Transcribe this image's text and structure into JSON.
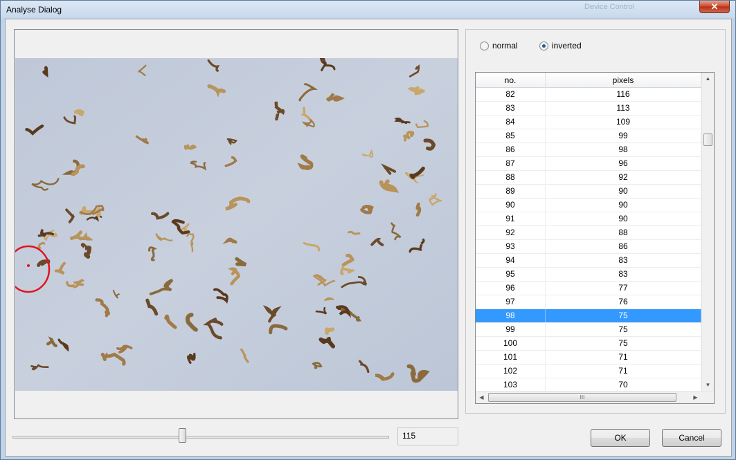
{
  "window": {
    "title": "Analyse Dialog",
    "background_title": "Device Control",
    "close_symbol": "✕"
  },
  "mode": {
    "normal_label": "normal",
    "inverted_label": "inverted",
    "selected": "inverted"
  },
  "table": {
    "columns": [
      "no.",
      "pixels"
    ],
    "rows": [
      [
        "82",
        "116"
      ],
      [
        "83",
        "113"
      ],
      [
        "84",
        "109"
      ],
      [
        "85",
        "99"
      ],
      [
        "86",
        "98"
      ],
      [
        "87",
        "96"
      ],
      [
        "88",
        "92"
      ],
      [
        "89",
        "90"
      ],
      [
        "90",
        "90"
      ],
      [
        "91",
        "90"
      ],
      [
        "92",
        "88"
      ],
      [
        "93",
        "86"
      ],
      [
        "94",
        "83"
      ],
      [
        "95",
        "83"
      ],
      [
        "96",
        "77"
      ],
      [
        "97",
        "76"
      ],
      [
        "98",
        "75"
      ],
      [
        "99",
        "75"
      ],
      [
        "100",
        "75"
      ],
      [
        "101",
        "71"
      ],
      [
        "102",
        "71"
      ],
      [
        "103",
        "70"
      ]
    ],
    "selected_no": "98",
    "hscroll_grip": "III"
  },
  "threshold": {
    "value": "115",
    "slider_fraction": 0.45
  },
  "buttons": {
    "ok": "OK",
    "cancel": "Cancel"
  },
  "colors": {
    "selection": "#3399ff",
    "highlight_circle": "#e0141e"
  }
}
